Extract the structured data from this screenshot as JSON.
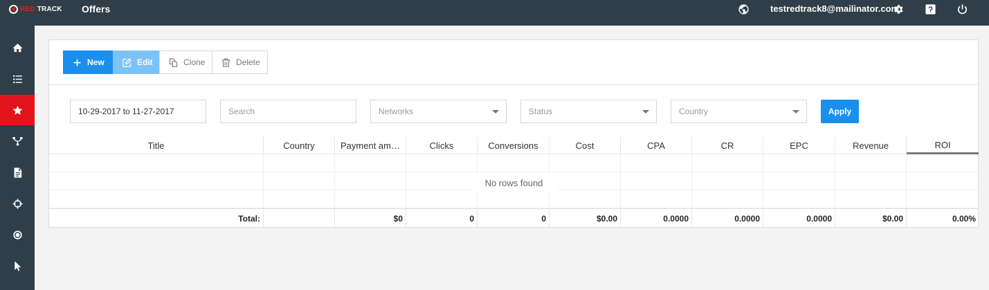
{
  "brand": {
    "logo_red": "RED",
    "logo_white": "TRACK"
  },
  "header": {
    "title": "Offers",
    "user_email": "testredtrack8@mailinator.com",
    "icons": [
      "globe-icon",
      "gear-icon",
      "help-icon",
      "power-icon"
    ]
  },
  "sidebar": {
    "items": [
      {
        "name": "home",
        "icon": "home-icon",
        "active": false
      },
      {
        "name": "list",
        "icon": "list-icon",
        "active": false
      },
      {
        "name": "offers",
        "icon": "star-icon",
        "active": true
      },
      {
        "name": "funnels",
        "icon": "funnel-icon",
        "active": false
      },
      {
        "name": "reports",
        "icon": "document-icon",
        "active": false
      },
      {
        "name": "targeting",
        "icon": "crosshair-icon",
        "active": false
      },
      {
        "name": "conversions",
        "icon": "target-icon",
        "active": false
      },
      {
        "name": "clicks",
        "icon": "cursor-icon",
        "active": false
      }
    ]
  },
  "toolbar": {
    "new_label": "New",
    "edit_label": "Edit",
    "clone_label": "Clone",
    "delete_label": "Delete"
  },
  "filters": {
    "date_range": "10-29-2017 to 11-27-2017",
    "search_placeholder": "Search",
    "networks_placeholder": "Networks",
    "status_placeholder": "Status",
    "country_placeholder": "Country",
    "apply_label": "Apply"
  },
  "table": {
    "columns": [
      "Title",
      "Country",
      "Payment am…",
      "Clicks",
      "Conversions",
      "Cost",
      "CPA",
      "CR",
      "EPC",
      "Revenue",
      "ROI"
    ],
    "empty_message": "No rows found",
    "totals": {
      "label": "Total:",
      "country": "",
      "payment": "$0",
      "clicks": "0",
      "conversions": "0",
      "cost": "$0.00",
      "cpa": "0.0000",
      "cr": "0.0000",
      "epc": "0.0000",
      "revenue": "$0.00",
      "roi": "0.00%"
    }
  },
  "colors": {
    "topbar": "#2f3e48",
    "accent_blue": "#1b8fee",
    "active_red": "#e2151d"
  }
}
